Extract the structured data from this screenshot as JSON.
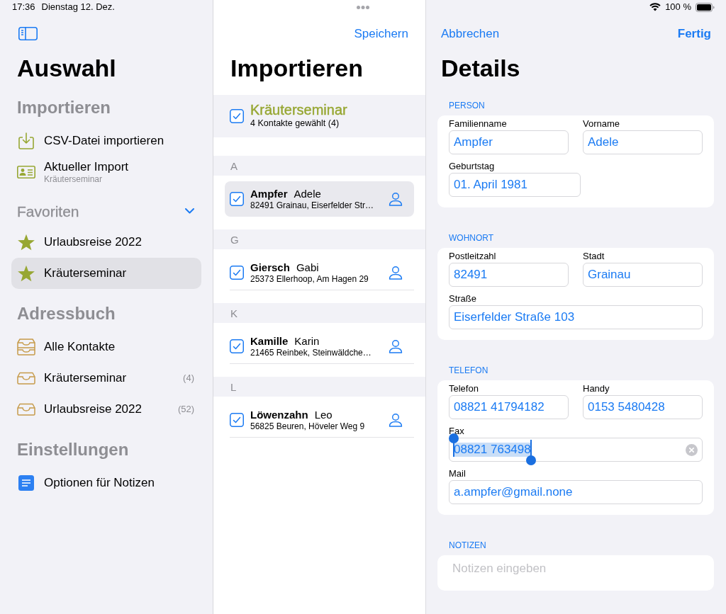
{
  "status_bar": {
    "time": "17:36",
    "date": "Dienstag 12. Dez.",
    "battery": "100 %"
  },
  "sidebar": {
    "title": "Auswahl",
    "sections": [
      {
        "kind": "heading",
        "title": "Importieren",
        "items": [
          {
            "kind": "import",
            "label": "CSV-Datei importieren",
            "selected": false
          },
          {
            "kind": "current",
            "label": "Aktueller Import",
            "subtitle": "Kräuterseminar",
            "selected": false
          }
        ]
      },
      {
        "kind": "disclosure",
        "title": "Favoriten",
        "expanded": true,
        "items": [
          {
            "kind": "favorite",
            "label": "Urlaubsreise 2022",
            "selected": false
          },
          {
            "kind": "favorite",
            "label": "Kräuterseminar",
            "selected": true
          }
        ]
      },
      {
        "kind": "heading",
        "title": "Adressbuch",
        "items": [
          {
            "kind": "all",
            "label": "Alle Kontakte",
            "selected": false
          },
          {
            "kind": "group",
            "label": "Kräuterseminar",
            "count": "(4)",
            "selected": false
          },
          {
            "kind": "group",
            "label": "Urlaubsreise 2022",
            "count": "(52)",
            "selected": false
          }
        ]
      },
      {
        "kind": "heading",
        "title": "Einstellungen",
        "items": [
          {
            "kind": "setting",
            "label": "Optionen für Notizen",
            "selected": false
          }
        ]
      }
    ]
  },
  "import_list": {
    "save": "Speichern",
    "title": "Importieren",
    "group": {
      "title": "Kräuterseminar",
      "subtitle": "4 Kontakte gewählt (4)",
      "checked": true
    },
    "sections": [
      {
        "letter": "A",
        "contacts": [
          {
            "last_name": "Ampfer",
            "first_name": "Adele",
            "address": "82491 Grainau, Eiserfelder Str…",
            "checked": true,
            "selected": true
          }
        ]
      },
      {
        "letter": "G",
        "contacts": [
          {
            "last_name": "Giersch",
            "first_name": "Gabi",
            "address": "25373 Ellerhoop, Am Hagen 29",
            "checked": true,
            "selected": false
          }
        ]
      },
      {
        "letter": "K",
        "contacts": [
          {
            "last_name": "Kamille",
            "first_name": "Karin",
            "address": "21465 Reinbek, Steinwäldche…",
            "checked": true,
            "selected": false
          }
        ]
      },
      {
        "letter": "L",
        "contacts": [
          {
            "last_name": "Löwenzahn",
            "first_name": "Leo",
            "address": "56825 Beuren, Höveler Weg 9",
            "checked": true,
            "selected": false
          }
        ]
      }
    ]
  },
  "details": {
    "cancel": "Abbrechen",
    "done": "Fertig",
    "title": "Details",
    "sections": [
      {
        "title": "PERSON",
        "rows": [
          [
            {
              "kind": "text",
              "label": "Familienname",
              "value": "Ampfer",
              "text_selected": false
            },
            {
              "kind": "text",
              "label": "Vorname",
              "value": "Adele",
              "text_selected": false
            }
          ],
          [
            {
              "kind": "date",
              "label": "Geburtstag",
              "value": "01. April 1981",
              "text_selected": false
            }
          ]
        ]
      },
      {
        "title": "WOHNORT",
        "rows": [
          [
            {
              "kind": "text",
              "label": "Postleitzahl",
              "value": "82491",
              "text_selected": false
            },
            {
              "kind": "text",
              "label": "Stadt",
              "value": "Grainau",
              "text_selected": false
            }
          ],
          [
            {
              "kind": "text",
              "label": "Straße",
              "value": "Eiserfelder Straße 103",
              "text_selected": false
            }
          ]
        ]
      },
      {
        "title": "TELEFON",
        "rows": [
          [
            {
              "kind": "text",
              "label": "Telefon",
              "value": "08821 41794182",
              "text_selected": false
            },
            {
              "kind": "text",
              "label": "Handy",
              "value": "0153 5480428",
              "text_selected": false
            }
          ],
          [
            {
              "kind": "text",
              "label": "Fax",
              "value": "08821 763498",
              "text_selected": true
            }
          ],
          [
            {
              "kind": "text",
              "label": "Mail",
              "value": "a.ampfer@gmail.none",
              "text_selected": false
            }
          ]
        ]
      }
    ],
    "notes": {
      "title": "NOTIZEN",
      "placeholder": "Notizen eingeben"
    }
  }
}
